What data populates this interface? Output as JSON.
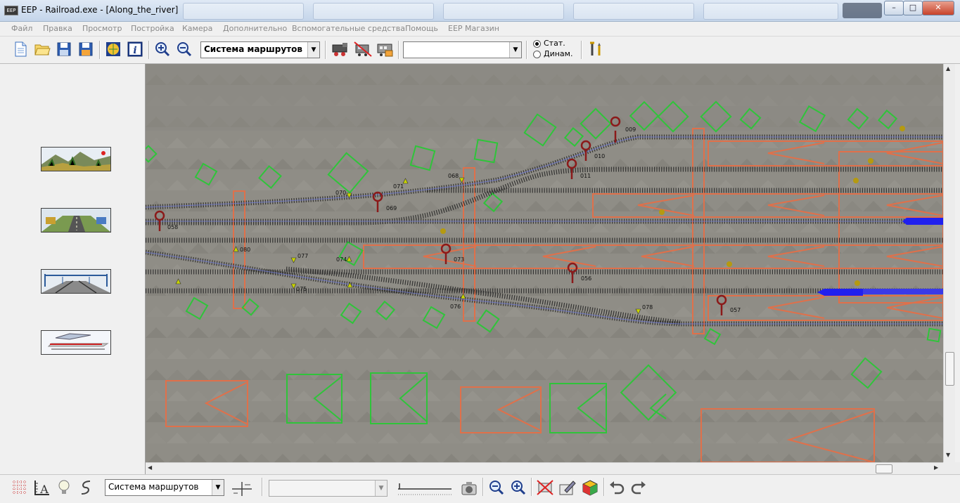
{
  "window": {
    "title": "EEP - Railroad.exe - [Along_the_river]",
    "app_icon": "EEP",
    "buttons": {
      "minimize": "–",
      "maximize": "□",
      "close": "✕"
    }
  },
  "menu": [
    "Файл",
    "Правка",
    "Просмотр",
    "Постройка",
    "Камера",
    "Дополнительно",
    "Вспомогательные средства",
    "Помощь",
    "EEP Магазин"
  ],
  "toolbar": {
    "icons": [
      "new-icon",
      "open-icon",
      "save-icon",
      "save-as-icon",
      "globe-icon",
      "info-icon",
      "zoom-in-icon",
      "zoom-out-icon"
    ],
    "mode_select": "Система маршрутов",
    "train_icons": [
      "locomotive-icon",
      "railcar-icon",
      "wagon-icon"
    ],
    "object_select": "",
    "radio_static": "Стат.",
    "radio_dynamic": "Динам.",
    "radio_selected": "static",
    "tools_icon": "tools-icon"
  },
  "left_panel": {
    "layers": [
      {
        "name": "layer-landscape",
        "icon": "landscape-thumbnail"
      },
      {
        "name": "layer-roads",
        "icon": "road-thumbnail"
      },
      {
        "name": "layer-tracks",
        "icon": "tracks-thumbnail"
      },
      {
        "name": "layer-trams",
        "icon": "train-thumbnail"
      }
    ]
  },
  "map": {
    "signals": [
      "009",
      "010",
      "011",
      "069",
      "058",
      "073",
      "056",
      "057"
    ],
    "switches": [
      "070",
      "071",
      "068",
      "080",
      "077",
      "074",
      "075",
      "076",
      "078"
    ],
    "colors": {
      "ground": "#8f8d86",
      "track": "#2a2a2a",
      "signal": "#8b1a1a",
      "structure_green": "#2fc43a",
      "structure_orange": "#e0704a",
      "train": "#2020ee",
      "switch": "#c8d400"
    }
  },
  "bottom_toolbar": {
    "left_icons": [
      "grid-icon",
      "ruler-icon",
      "bulb-icon",
      "curve-icon"
    ],
    "mode_select": "Система маршрутов",
    "track_icon": "track-switch-icon",
    "object_select": "",
    "slider_icon": "slider-icon",
    "right_icons": [
      "camera-icon",
      "zoom-out-icon",
      "zoom-in-icon",
      "delete-icon",
      "edit-icon",
      "cube-icon",
      "undo-icon",
      "redo-icon"
    ]
  }
}
